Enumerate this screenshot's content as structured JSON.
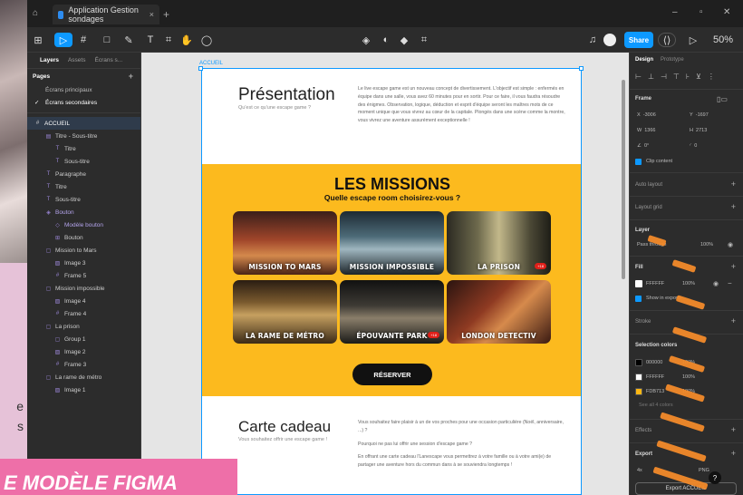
{
  "window": {
    "tab_title": "Application Gestion sondages",
    "close_glyph": "×",
    "new_tab_glyph": "+",
    "minimize_glyph": "–",
    "maximize_glyph": "▫",
    "close_window_glyph": "✕"
  },
  "toolbar": {
    "tools": [
      {
        "name": "main-menu",
        "glyph": "⊞"
      },
      {
        "name": "move-tool",
        "glyph": "▷"
      },
      {
        "name": "frame-tool",
        "glyph": "#"
      },
      {
        "name": "shape-tool",
        "glyph": "□"
      },
      {
        "name": "pen-tool",
        "glyph": "✎"
      },
      {
        "name": "text-tool",
        "glyph": "T"
      },
      {
        "name": "resource-tool",
        "glyph": "⌗"
      },
      {
        "name": "hand-tool",
        "glyph": "✋"
      },
      {
        "name": "comment-tool",
        "glyph": "◯"
      }
    ],
    "share_label": "Share",
    "zoom": "50%"
  },
  "left_panel": {
    "tabs": [
      "Layers",
      "Assets",
      "Écrans s..."
    ],
    "pages_label": "Pages",
    "pages": [
      "Écrans principaux",
      "Écrans secondaires"
    ],
    "root_layer": "ACCUEIL",
    "layers": [
      {
        "label": "Titre - Sous-titre",
        "indent": 1,
        "glyph": "▤"
      },
      {
        "label": "Titre",
        "indent": 2,
        "glyph": "T"
      },
      {
        "label": "Sous-titre",
        "indent": 2,
        "glyph": "T"
      },
      {
        "label": "Paragraphe",
        "indent": 1,
        "glyph": "T"
      },
      {
        "label": "Titre",
        "indent": 1,
        "glyph": "T"
      },
      {
        "label": "Sous-titre",
        "indent": 1,
        "glyph": "T"
      },
      {
        "label": "Bouton",
        "indent": 1,
        "glyph": "◈"
      },
      {
        "label": "Modèle bouton",
        "indent": 2,
        "glyph": "◇"
      },
      {
        "label": "Bouton",
        "indent": 2,
        "glyph": "⊞"
      },
      {
        "label": "Mission to Mars",
        "indent": 1,
        "glyph": "▢"
      },
      {
        "label": "Image 3",
        "indent": 2,
        "glyph": "▨"
      },
      {
        "label": "Frame 5",
        "indent": 2,
        "glyph": "#"
      },
      {
        "label": "Mission impossible",
        "indent": 1,
        "glyph": "▢"
      },
      {
        "label": "Image 4",
        "indent": 2,
        "glyph": "▨"
      },
      {
        "label": "Frame 4",
        "indent": 2,
        "glyph": "#"
      },
      {
        "label": "La prison",
        "indent": 1,
        "glyph": "▢"
      },
      {
        "label": "Group 1",
        "indent": 2,
        "glyph": "▢"
      },
      {
        "label": "Image 2",
        "indent": 2,
        "glyph": "▨"
      },
      {
        "label": "Frame 3",
        "indent": 2,
        "glyph": "#"
      },
      {
        "label": "La rame de métro",
        "indent": 1,
        "glyph": "▢"
      },
      {
        "label": "Image 1",
        "indent": 2,
        "glyph": "▨"
      }
    ]
  },
  "canvas": {
    "frame_label": "ACCUEIL",
    "presentation": {
      "title": "Présentation",
      "subtitle": "Qu'est ce qu'une escape game ?",
      "paragraph": "Le live escape game est un nouveau concept de divertissement. L'objectif est simple : enfermés en équipe dans une salle, vous avez 60 minutes pour en sortir. Pour ce faire, il vous faudra résoudre des énigmes. Observation, logique, déduction et esprit d'équipe seront les maîtres mots de ce moment unique que vous vivrez au cœur de la capitale. Plongés dans une scène comme la montre, vous vivrez une aventure assurément exceptionnelle !"
    },
    "missions": {
      "title": "LES MISSIONS",
      "subtitle": "Quelle escape room choisirez-vous ?",
      "cards": [
        {
          "label": "MISSION TO MARS",
          "badge": "",
          "bg": "linear-gradient(180deg,#3a1f1a 0%,#a0452a 45%,#d4894c 70%,#4a2316 100%)"
        },
        {
          "label": "MISSION IMPOSSIBLE",
          "badge": "",
          "bg": "linear-gradient(180deg,#1d2a33 0%,#4d6b78 40%,#9fb6bf 60%,#1b2328 100%)"
        },
        {
          "label": "LA PRISON",
          "badge": "+18",
          "bg": "linear-gradient(90deg,#2b2a22 0%,#6e6a4d 30%,#c2b88a 50%,#4c4936 80%,#1e1d17 100%)"
        },
        {
          "label": "LA RAME DE MÉTRO",
          "badge": "",
          "bg": "linear-gradient(180deg,#2a1d12 0%,#7a5a2e 35%,#c6a060 55%,#3b2a16 100%)"
        },
        {
          "label": "ÉPOUVANTE PARK",
          "badge": "+18",
          "bg": "linear-gradient(180deg,#111 0%,#3d3a34 40%,#8a7e6a 60%,#1a1a18 100%)"
        },
        {
          "label": "LONDON DETECTIV",
          "badge": "",
          "bg": "linear-gradient(135deg,#2a1410 0%,#8e3a22 40%,#d68a4c 60%,#3a1a12 100%)"
        }
      ],
      "button": "RÉSERVER"
    },
    "cadeau": {
      "title": "Carte cadeau",
      "subtitle": "Vous souhaitez offrir une escape game !",
      "paragraphs": [
        "Vous souhaitez faire plaisir à un de vos proches pour une occasion particulière (Noël, anniversaire, ...) ?",
        "Pourquoi ne pas lui offrir une session d'escape game ?",
        "En offrant une carte cadeau l'Lanescape vous permettrez à votre famille ou à votre ami(e) de partager une aventure hors du commun dans à se souviendra longtemps !"
      ]
    }
  },
  "right_panel": {
    "tabs": [
      "Design",
      "Prototype"
    ],
    "frame_label": "Frame",
    "x": "-3006",
    "y": "-1697",
    "w": "1366",
    "h": "2713",
    "rotation": "0°",
    "radius": "0",
    "clip_content": "Clip content",
    "auto_layout": "Auto layout",
    "layout_grid": "Layout grid",
    "layer": "Layer",
    "blend": "Pass through",
    "layer_opacity": "100%",
    "fill": "Fill",
    "fill_hex": "FFFFFF",
    "fill_opacity": "100%",
    "show_in_exports": "Show in exports",
    "stroke": "Stroke",
    "selection_colors": "Selection colors",
    "colors": [
      {
        "hex": "000000",
        "opacity": "100%",
        "color": "#000000"
      },
      {
        "hex": "FFFFFF",
        "opacity": "100%",
        "color": "#FFFFFF"
      },
      {
        "hex": "FDB713",
        "opacity": "100%",
        "color": "#FDB713"
      }
    ],
    "see_all": "See all 4 colors",
    "effects": "Effects",
    "export": "Export",
    "export_scale": "4x",
    "export_format": "PNG",
    "export_button": "Export ACCUEIL",
    "help": "?"
  },
  "background": {
    "banner_text": "E MODÈLE FIGMA",
    "fragment_1": "e",
    "fragment_2": "s"
  }
}
